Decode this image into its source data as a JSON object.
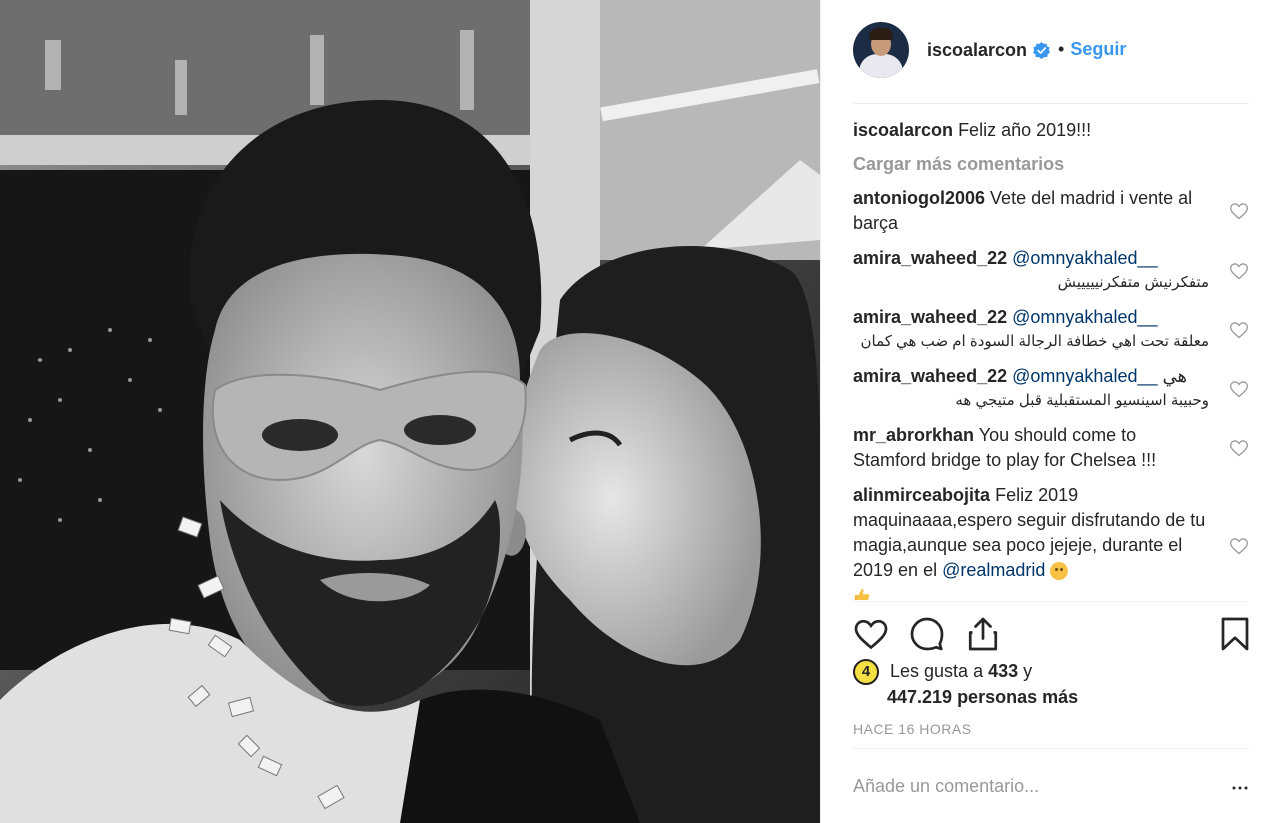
{
  "post": {
    "username": "isco​alarcon",
    "verified": true,
    "follow_label": "Seguir",
    "dot": "•",
    "caption": {
      "user": "iscoalarcon",
      "text": "Feliz año 2019!!!"
    },
    "load_more_label": "Cargar más comentarios",
    "comments": [
      {
        "user": "antoniogol2006",
        "text": "Vete del madrid i vente al barça"
      },
      {
        "user": "amira_waheed_22",
        "mention": "@omnyakhaled__",
        "arabic": "متفكرنيش متفكرنيييييش"
      },
      {
        "user": "amira_waheed_22",
        "mention": "@omnyakhaled__",
        "arabic": "معلقة تحت اهي خطافة الرجالة السودة ام ضب هي كمان"
      },
      {
        "user": "amira_waheed_22",
        "mention": "@omnyakhaled__",
        "arabic_inline": "هي",
        "arabic": "وحبيبة اسينسيو المستقبلية قبل متيجي هه"
      },
      {
        "user": "mr_abrorkhan",
        "text": "You should come to Stamford bridge to play for Chelsea !!!"
      },
      {
        "user": "alinmirceabojita",
        "text": "Feliz 2019 maquinaaaa,espero seguir disfrutando de tu magia,aunque sea poco jejeje, durante el 2019 en el",
        "mention": "@realmadrid"
      }
    ],
    "likes": {
      "badge": "4",
      "prefix": "Les gusta a",
      "count": "433",
      "conj": "y",
      "others": "447.219 personas más"
    },
    "time": "HACE 16 HORAS",
    "add_comment_placeholder": "Añade un comentario..."
  },
  "icons": {
    "verified": "verified-badge-icon",
    "like": "heart-icon",
    "comment": "comment-icon",
    "share": "share-icon",
    "save": "bookmark-icon",
    "more": "more-options-icon"
  },
  "colors": {
    "link": "#3897f0",
    "mention": "#003569",
    "muted": "#999999",
    "text": "#262626",
    "divider": "#efefef"
  }
}
